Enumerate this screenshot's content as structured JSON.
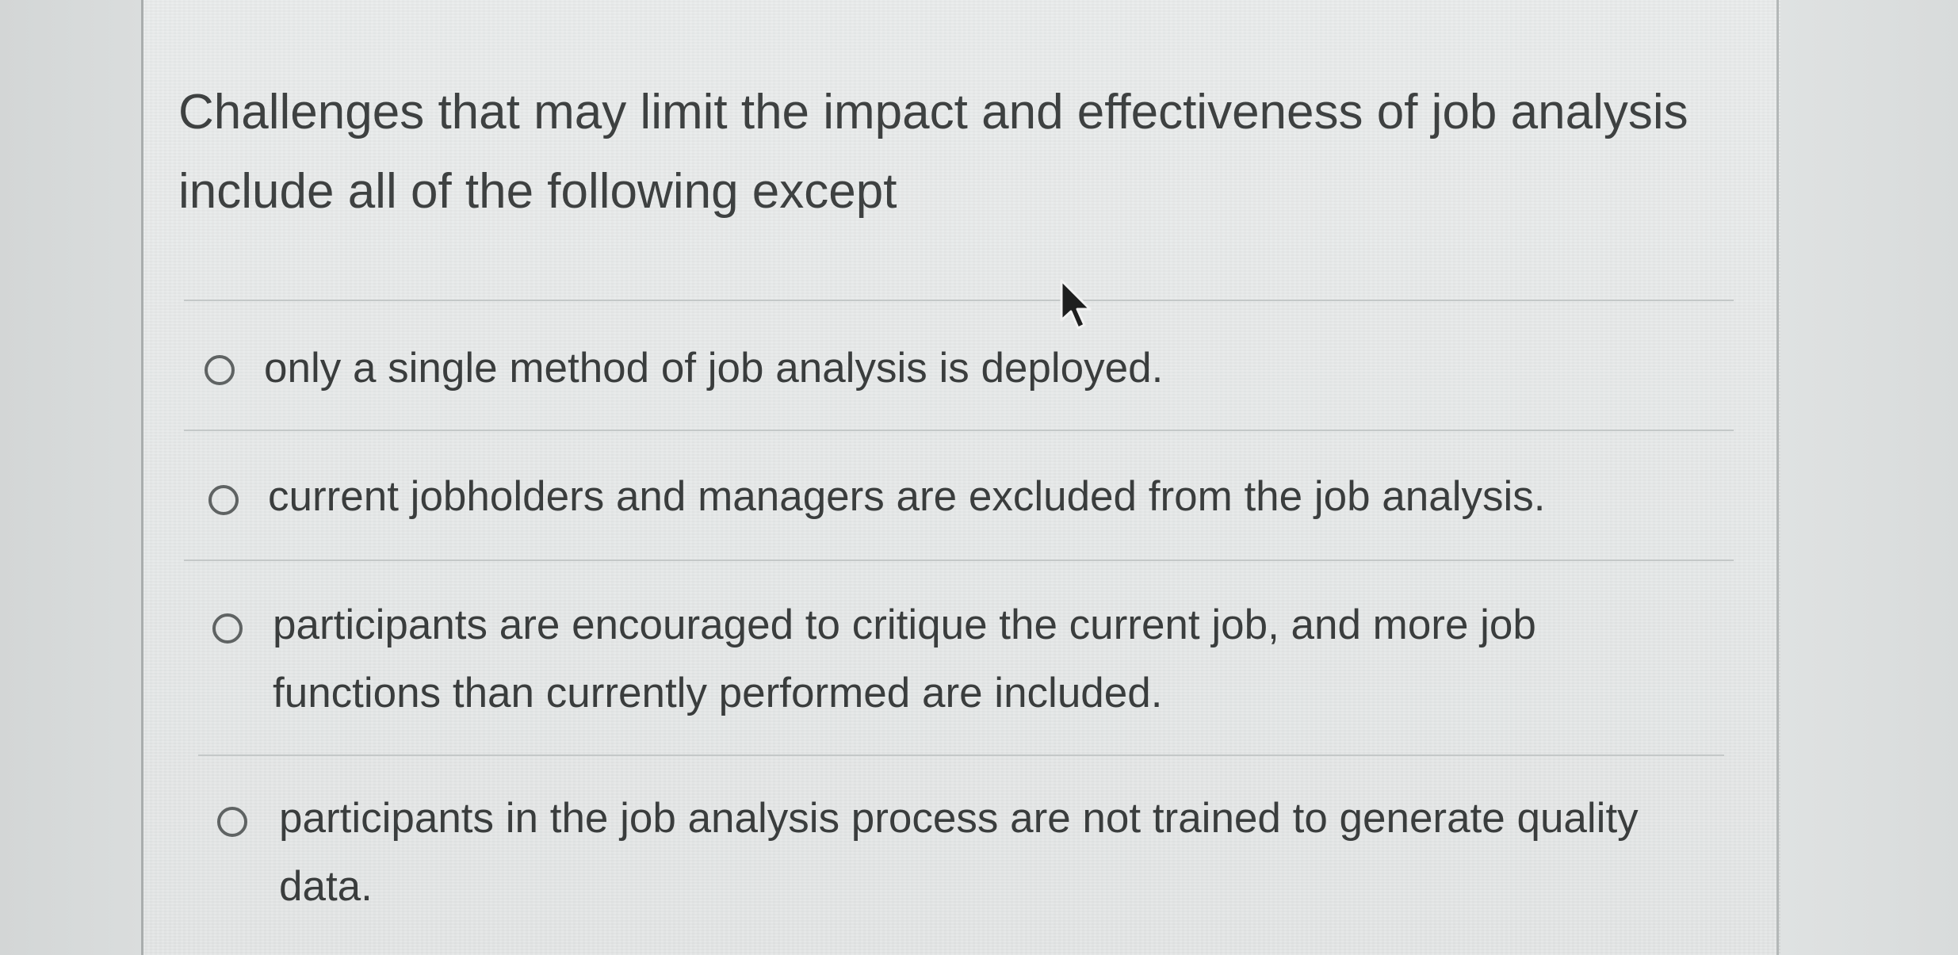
{
  "question": {
    "text": "Challenges that may limit the impact and effectiveness of job analysis include all of the following except"
  },
  "options": [
    {
      "label": "only a single method of job analysis is deployed.",
      "selected": false
    },
    {
      "label": "current jobholders and managers are excluded from the job analysis.",
      "selected": false
    },
    {
      "label": "participants are encouraged to critique the current job, and more job functions than currently performed are included.",
      "selected": false
    },
    {
      "label": "participants in the job analysis process are not trained to generate quality data.",
      "selected": false
    }
  ],
  "icons": {
    "radio": "radio-unselected-icon",
    "cursor": "mouse-pointer-icon"
  },
  "colors": {
    "text": "#3e4141",
    "radio_border": "#5f6363",
    "divider": "#c4c8c8",
    "background": "#d9dcdc"
  }
}
